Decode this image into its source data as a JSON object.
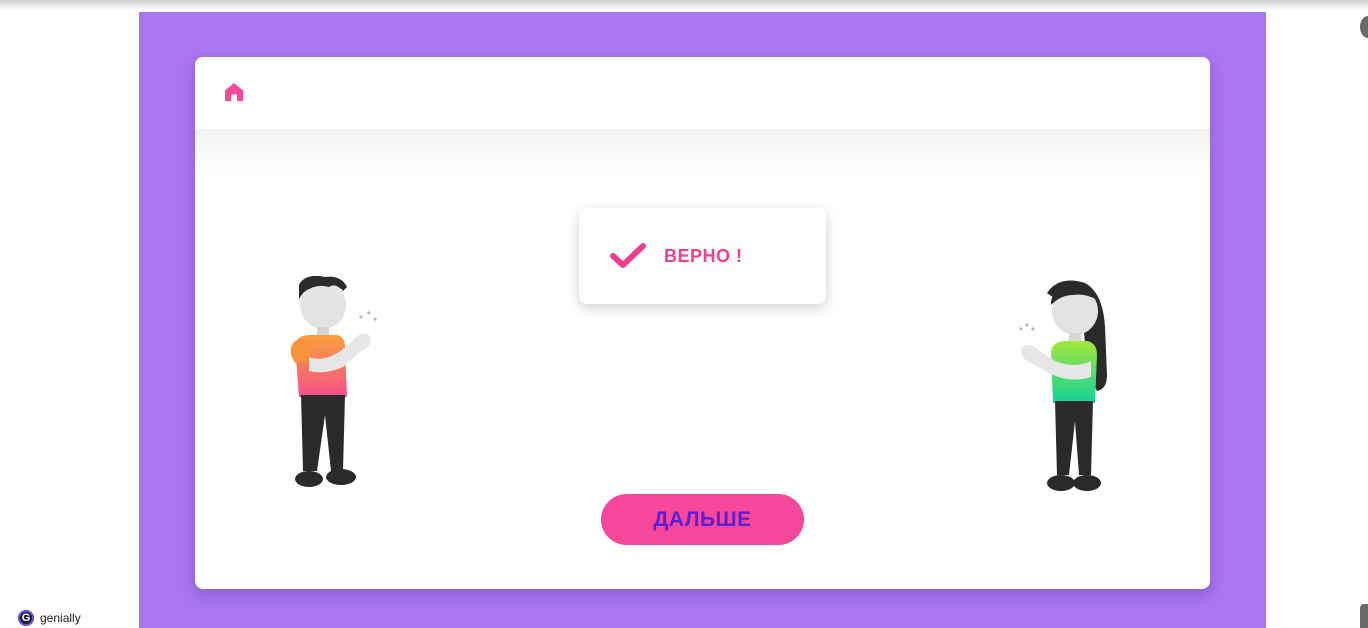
{
  "feedback": {
    "icon": "checkmark-icon",
    "text": "ВЕРНО !"
  },
  "navigation": {
    "home_icon": "home-icon",
    "next_label": "ДАЛЬШЕ"
  },
  "branding": {
    "logo_letter": "G",
    "name": "genially"
  },
  "colors": {
    "stage_background": "#a776f0",
    "accent_pink": "#f6479a",
    "button_text": "#5a1fd6",
    "card_background": "#ffffff"
  },
  "illustrations": [
    {
      "name": "man-clapping-figure",
      "shirt_gradient": [
        "#f9a13a",
        "#f5508a"
      ]
    },
    {
      "name": "woman-clapping-figure",
      "shirt_gradient": [
        "#a4e83a",
        "#11d29a"
      ]
    }
  ]
}
